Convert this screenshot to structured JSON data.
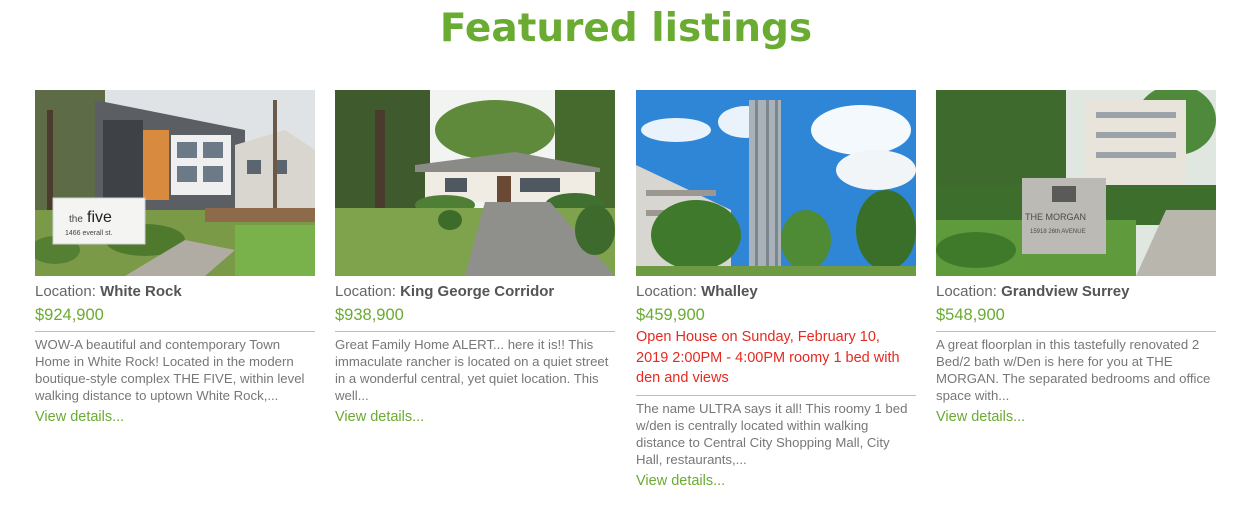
{
  "section_title": "Featured listings",
  "location_prefix": "Location:",
  "view_label": "View details...",
  "listings": [
    {
      "location": "White Rock",
      "price": "$924,900",
      "description": "WOW-A beautiful and contemporary Town Home in White Rock! Located in the modern boutique-style complex THE FIVE, within level walking distance to uptown White Rock,...",
      "sign_small": "the",
      "sign_big": "five",
      "sign_addr": "1466 everall st."
    },
    {
      "location": "King George Corridor",
      "price": "$938,900",
      "description": "Great Family Home ALERT... here it is!! This immaculate rancher is located on a quiet street in a wonderful central, yet quiet location. This well..."
    },
    {
      "location": "Whalley",
      "price": "$459,900",
      "open_house": "Open House on Sunday, February 10, 2019 2:00PM - 4:00PM roomy 1 bed with den and views",
      "description": "The name ULTRA says it all! This roomy 1 bed w/den is centrally located within walking distance to Central City Shopping Mall, City Hall, restaurants,..."
    },
    {
      "location": "Grandview Surrey",
      "price": "$548,900",
      "description": "A great floorplan in this tastefully renovated 2 Bed/2 bath w/Den is here for you at THE MORGAN. The separated bedrooms and office space with...",
      "sign_text": "THE MORGAN",
      "sign_addr": "15918 26th AVENUE"
    }
  ],
  "colors": {
    "accent": "#6aab32",
    "alert": "#e52a21",
    "text": "#666666"
  }
}
